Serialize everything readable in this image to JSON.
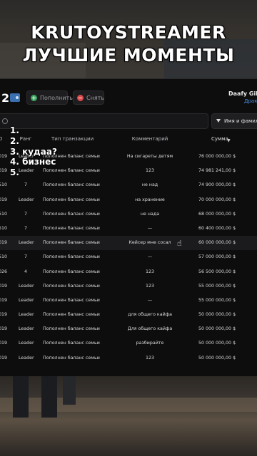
{
  "title": {
    "line1": "KRUTOYSTREAMER",
    "line2": "ЛУЧШИЕ МОМЕНТЫ"
  },
  "toolbar": {
    "number": "2",
    "add_label": "Пополнить",
    "take_label": "Снять",
    "user_name": "Daafy Gilm",
    "user_sub": "Драк"
  },
  "search": {
    "placeholder": ""
  },
  "filter": {
    "label": "Имя и фамилия"
  },
  "columns": {
    "id": "D",
    "rank": "Ранг",
    "type": "Тип транзакции",
    "comment": "Комментарий",
    "sum": "Сумма"
  },
  "rows": [
    {
      "id": "019",
      "rank": "Leader",
      "type": "Пополнен баланс семьи",
      "comment": "На сигареты детям",
      "sum": "76 000 000,00 $"
    },
    {
      "id": "019",
      "rank": "Leader",
      "type": "Пополнен баланс семьи",
      "comment": "123",
      "sum": "74 981 241,00 $"
    },
    {
      "id": "510",
      "rank": "7",
      "type": "Пополнен баланс семьи",
      "comment": "не над",
      "sum": "74 900 000,00 $"
    },
    {
      "id": "019",
      "rank": "Leader",
      "type": "Пополнен баланс семьи",
      "comment": "на хранение",
      "sum": "70 000 000,00 $"
    },
    {
      "id": "510",
      "rank": "7",
      "type": "Пополнен баланс семьи",
      "comment": "не нада",
      "sum": "68 000 000,00 $"
    },
    {
      "id": "510",
      "rank": "7",
      "type": "Пополнен баланс семьи",
      "comment": "—",
      "sum": "60 400 000,00 $"
    },
    {
      "id": "019",
      "rank": "Leader",
      "type": "Пополнен баланс семьи",
      "comment": "Кейсер мне сосал",
      "sum": "60 000 000,00 $"
    },
    {
      "id": "510",
      "rank": "7",
      "type": "Пополнен баланс семьи",
      "comment": "—",
      "sum": "57 000 000,00 $"
    },
    {
      "id": "026",
      "rank": "4",
      "type": "Пополнен баланс семьи",
      "comment": "123",
      "sum": "56 500 000,00 $"
    },
    {
      "id": "019",
      "rank": "Leader",
      "type": "Пополнен баланс семьи",
      "comment": "123",
      "sum": "55 000 000,00 $"
    },
    {
      "id": "019",
      "rank": "Leader",
      "type": "Пополнен баланс семьи",
      "comment": "—",
      "sum": "55 000 000,00 $"
    },
    {
      "id": "019",
      "rank": "Leader",
      "type": "Пополнен баланс семьи",
      "comment": "для общего кайфа",
      "sum": "50 000 000,00 $"
    },
    {
      "id": "019",
      "rank": "Leader",
      "type": "Пополнен баланс семьи",
      "comment": "Для общего кайфа",
      "sum": "50 000 000,00 $"
    },
    {
      "id": "019",
      "rank": "Leader",
      "type": "Пополнен баланс семьи",
      "comment": "разбирайте",
      "sum": "50 000 000,00 $"
    },
    {
      "id": "019",
      "rank": "Leader",
      "type": "Пополнен баланс семьи",
      "comment": "123",
      "sum": "50 000 000,00 $"
    }
  ],
  "overlay_list": [
    "1.",
    "2.",
    "3. кудаа?",
    "4. бизнес",
    "5."
  ],
  "colors": {
    "panel": "#0d0d0e",
    "add": "#3ba55d",
    "take": "#d84a4a",
    "accent": "#4b8fe0"
  }
}
